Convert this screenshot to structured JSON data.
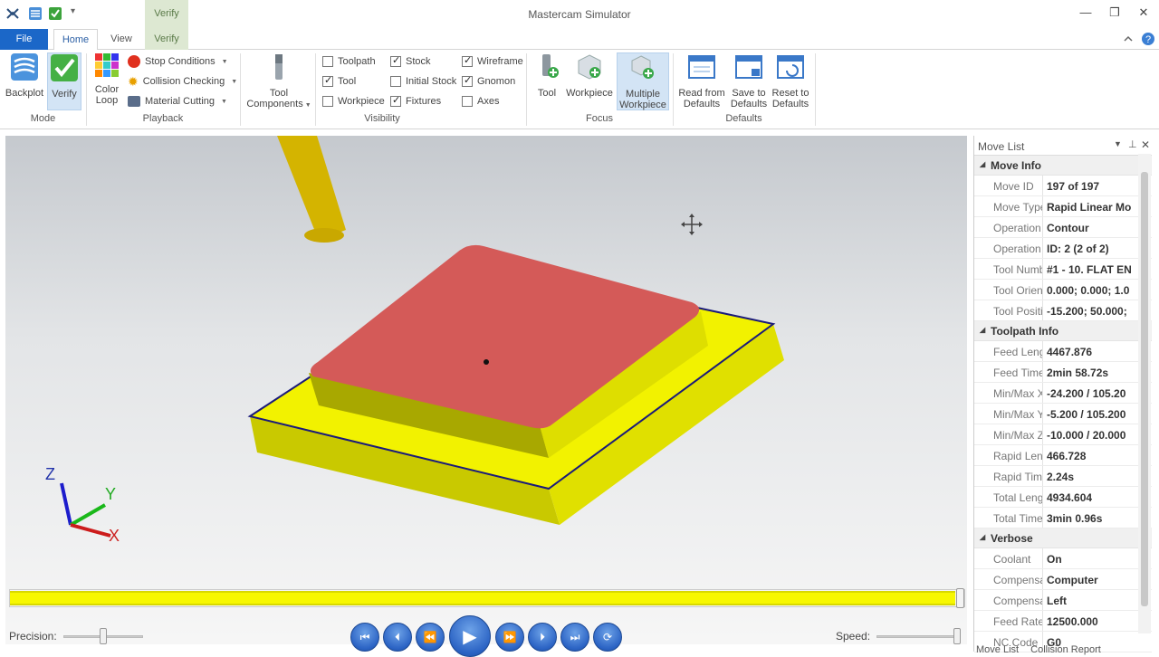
{
  "window": {
    "title": "Mastercam Simulator",
    "context_tab_header": "Verify",
    "buttons": {
      "minimize": "—",
      "restore": "❐",
      "close": "✕"
    }
  },
  "tabs": {
    "file": "File",
    "home": "Home",
    "view": "View",
    "verify": "Verify"
  },
  "ribbon": {
    "mode": {
      "label": "Mode",
      "backplot": "Backplot",
      "verify": "Verify"
    },
    "playback": {
      "label": "Playback",
      "color_loop_1": "Color",
      "color_loop_2": "Loop",
      "stop_conditions": "Stop Conditions",
      "collision_checking": "Collision Checking",
      "material_cutting": "Material Cutting"
    },
    "tool_components": {
      "line1": "Tool",
      "line2": "Components"
    },
    "visibility": {
      "label": "Visibility",
      "items": [
        {
          "label": "Toolpath",
          "checked": false
        },
        {
          "label": "Tool",
          "checked": true
        },
        {
          "label": "Workpiece",
          "checked": false
        },
        {
          "label": "Stock",
          "checked": true
        },
        {
          "label": "Initial Stock",
          "checked": false
        },
        {
          "label": "Fixtures",
          "checked": true
        },
        {
          "label": "Wireframe",
          "checked": true
        },
        {
          "label": "Gnomon",
          "checked": true
        },
        {
          "label": "Axes",
          "checked": false
        }
      ]
    },
    "focus": {
      "label": "Focus",
      "tool": "Tool",
      "workpiece": "Workpiece",
      "multiple_1": "Multiple",
      "multiple_2": "Workpiece"
    },
    "defaults": {
      "label": "Defaults",
      "read_1": "Read from",
      "read_2": "Defaults",
      "save_1": "Save to",
      "save_2": "Defaults",
      "reset_1": "Reset to",
      "reset_2": "Defaults"
    }
  },
  "viewport": {
    "gnomon": {
      "z": "Z",
      "y": "Y",
      "x": "X"
    }
  },
  "controls": {
    "precision_label": "Precision:",
    "speed_label": "Speed:",
    "progress_fraction": 1.0
  },
  "move_list": {
    "title": "Move List",
    "sections": [
      {
        "name": "Move Info",
        "rows": [
          {
            "k": "Move ID",
            "v": "197 of 197"
          },
          {
            "k": "Move Type",
            "v": "Rapid Linear Mo"
          },
          {
            "k": "Operation N",
            "v": "Contour"
          },
          {
            "k": "Operation N",
            "v": "ID: 2 (2 of 2)"
          },
          {
            "k": "Tool Numbe",
            "v": "#1 - 10. FLAT EN"
          },
          {
            "k": "Tool Orienta",
            "v": "0.000; 0.000; 1.0"
          },
          {
            "k": "Tool Positior",
            "v": "-15.200; 50.000;"
          }
        ]
      },
      {
        "name": "Toolpath Info",
        "rows": [
          {
            "k": "Feed Length",
            "v": "4467.876"
          },
          {
            "k": "Feed Time",
            "v": "2min 58.72s"
          },
          {
            "k": "Min/Max X",
            "v": "-24.200 / 105.20"
          },
          {
            "k": "Min/Max Y",
            "v": "-5.200 / 105.200"
          },
          {
            "k": "Min/Max Z",
            "v": "-10.000 / 20.000"
          },
          {
            "k": "Rapid Lengt",
            "v": "466.728"
          },
          {
            "k": "Rapid Time",
            "v": "2.24s"
          },
          {
            "k": "Total Length",
            "v": "4934.604"
          },
          {
            "k": "Total Time",
            "v": "3min 0.96s"
          }
        ]
      },
      {
        "name": "Verbose",
        "rows": [
          {
            "k": "Coolant",
            "v": "On"
          },
          {
            "k": "Compensatio",
            "v": "Computer"
          },
          {
            "k": "Compensatio",
            "v": "Left"
          },
          {
            "k": "Feed Rate",
            "v": "12500.000"
          },
          {
            "k": "NC Code",
            "v": "G0"
          }
        ]
      }
    ],
    "bottom_tabs": [
      "Move List",
      "Collision Report"
    ]
  }
}
